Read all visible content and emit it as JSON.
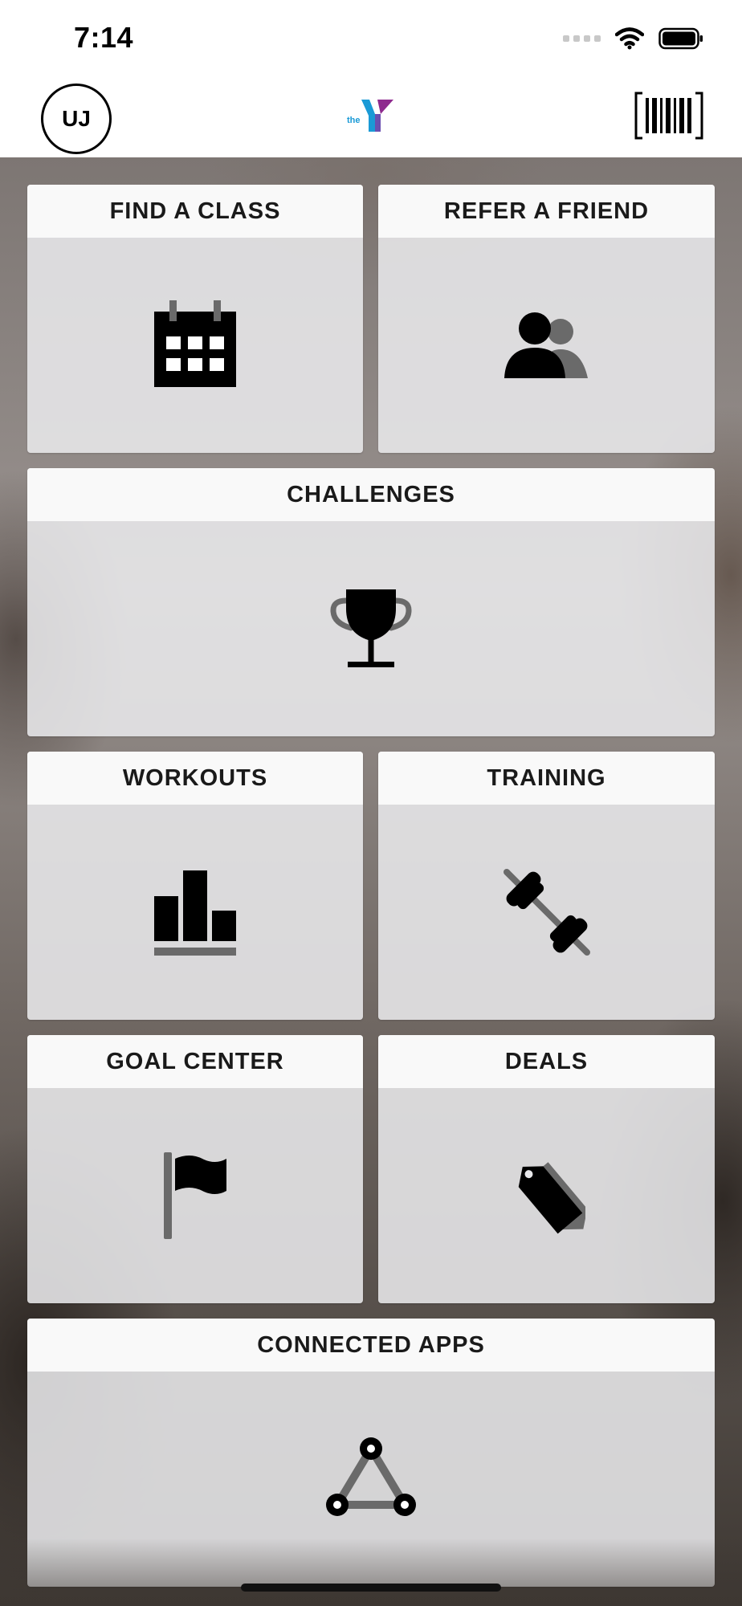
{
  "status_bar": {
    "time": "7:14"
  },
  "header": {
    "avatar_initials": "UJ",
    "logo_text": "the"
  },
  "tiles": [
    {
      "label": "FIND A CLASS",
      "icon": "calendar-icon"
    },
    {
      "label": "REFER A FRIEND",
      "icon": "people-icon"
    },
    {
      "label": "CHALLENGES",
      "icon": "trophy-icon"
    },
    {
      "label": "WORKOUTS",
      "icon": "bar-chart-icon"
    },
    {
      "label": "TRAINING",
      "icon": "dumbbell-icon"
    },
    {
      "label": "GOAL CENTER",
      "icon": "flag-icon"
    },
    {
      "label": "DEALS",
      "icon": "tag-icon"
    },
    {
      "label": "CONNECTED APPS",
      "icon": "connected-nodes-icon"
    }
  ],
  "colors": {
    "accent_blue": "#1a9ad6",
    "accent_purple": "#8e2a8e",
    "icon_black": "#000000",
    "icon_gray": "#6a6a6a"
  }
}
